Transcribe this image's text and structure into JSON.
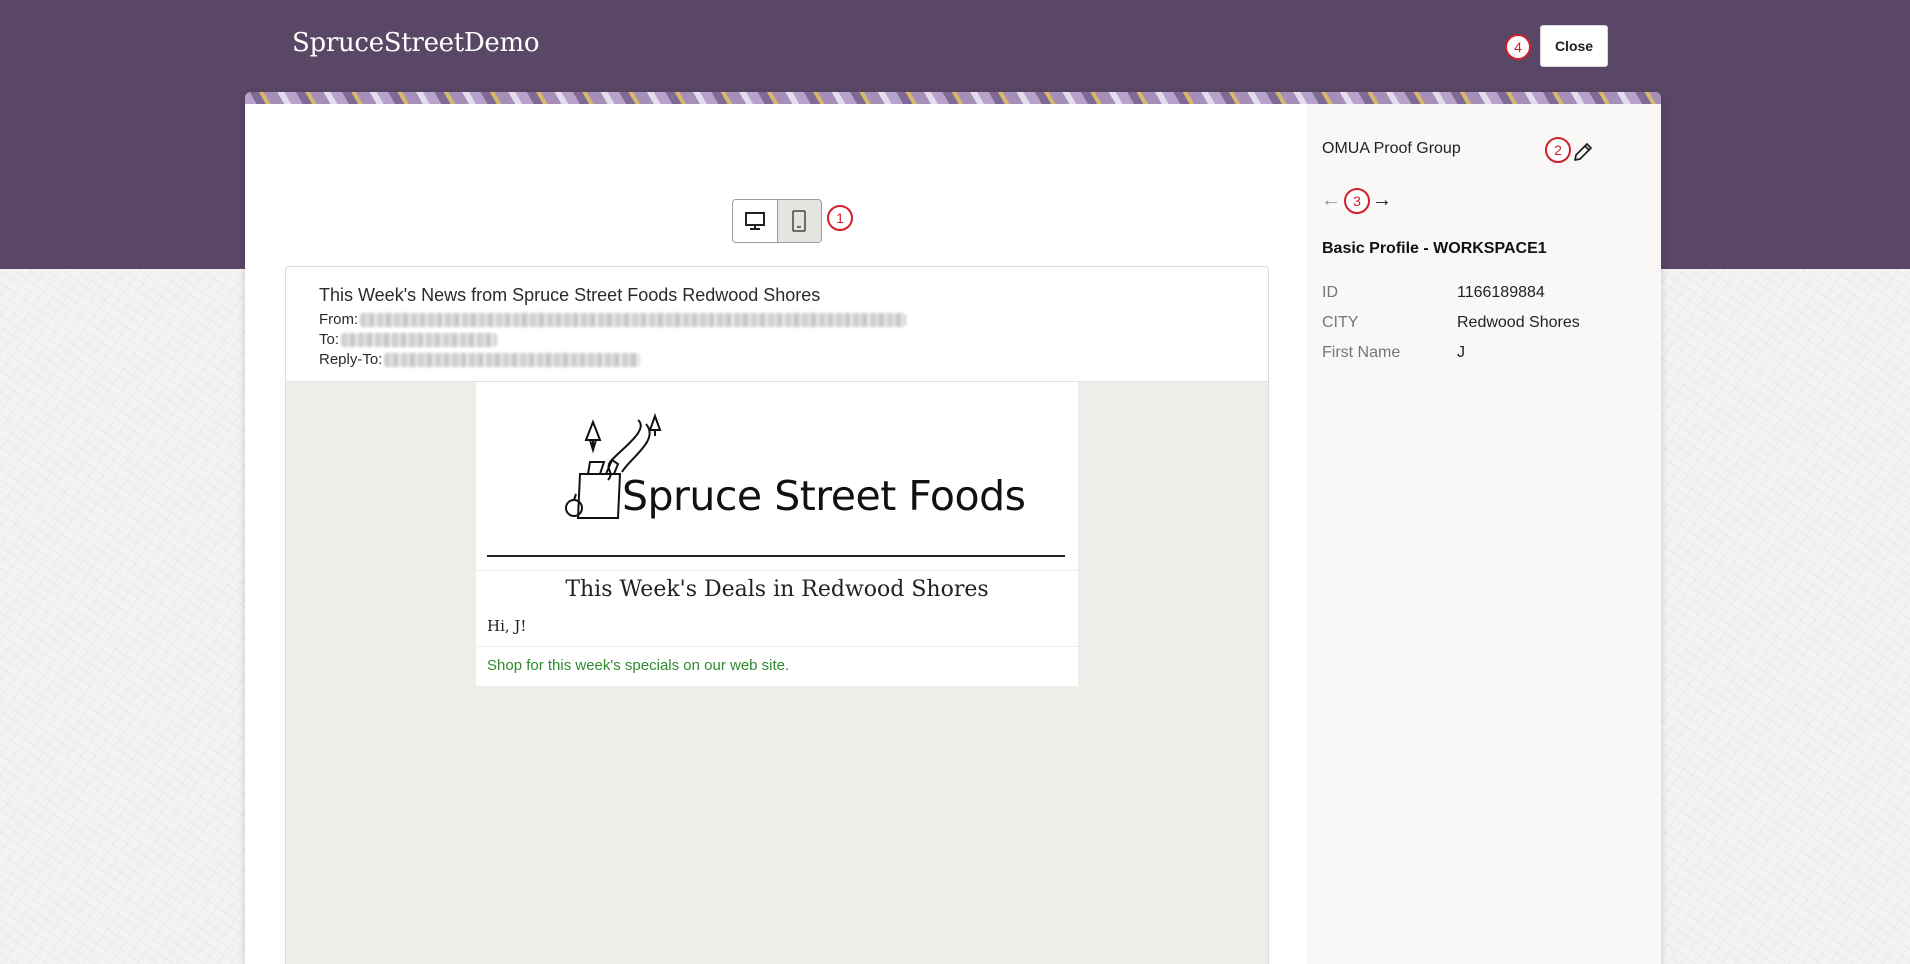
{
  "header": {
    "app_title": "SpruceStreetDemo",
    "close_label": "Close"
  },
  "markers": [
    "1",
    "2",
    "3",
    "4"
  ],
  "device_toggle": {
    "options": [
      {
        "name": "desktop",
        "icon": "desktop-icon",
        "active": true
      },
      {
        "name": "mobile",
        "icon": "mobile-icon",
        "active": false
      }
    ]
  },
  "email": {
    "subject": "This Week's News from Spruce Street Foods Redwood Shores",
    "from_label": "From:",
    "to_label": "To:",
    "reply_to_label": "Reply-To:",
    "logo_text": "Spruce Street Foods",
    "deals_heading": "This Week's Deals in  Redwood Shores",
    "greeting": "Hi,  J!",
    "shop_link": "Shop for this week's specials on our web site.",
    "link_color": "#2e8b2e"
  },
  "sidebar": {
    "proof_group": "OMUA Proof Group",
    "prev_arrow": "←",
    "next_arrow": "→",
    "profile_title": "Basic Profile - WORKSPACE1",
    "attributes": [
      {
        "label": "ID",
        "value": "1166189884"
      },
      {
        "label": "CITY",
        "value": "Redwood Shores"
      },
      {
        "label": "First Name",
        "value": "J"
      }
    ]
  },
  "colors": {
    "header_bg": "#5a4766",
    "marker": "#d0202a"
  }
}
